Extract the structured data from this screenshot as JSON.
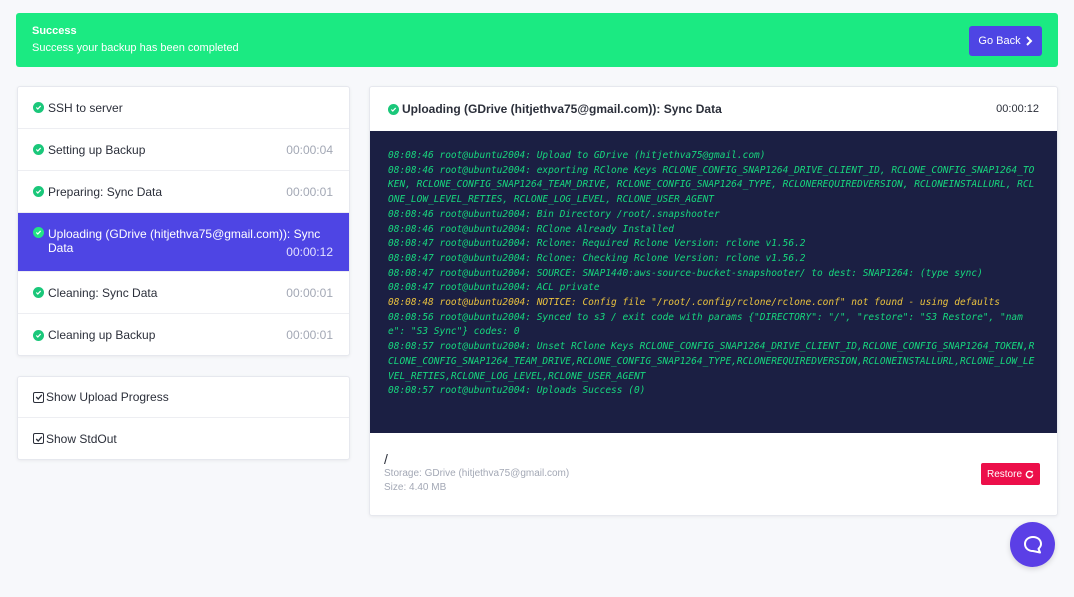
{
  "banner": {
    "title": "Success",
    "message": "Success your backup has been completed",
    "go_back_label": "Go Back",
    "bg_color": "#1bea82"
  },
  "steps": [
    {
      "label": "SSH to server",
      "duration": ""
    },
    {
      "label": "Setting up Backup",
      "duration": "00:00:04"
    },
    {
      "label": "Preparing: Sync Data",
      "duration": "00:00:01"
    },
    {
      "label": "Uploading (GDrive (hitjethva75@gmail.com)): Sync Data",
      "duration": "00:00:12",
      "active": true
    },
    {
      "label": "Cleaning: Sync Data",
      "duration": "00:00:01"
    },
    {
      "label": "Cleaning up Backup",
      "duration": "00:00:01"
    }
  ],
  "options": [
    {
      "label": "Show Upload Progress",
      "checked": true
    },
    {
      "label": "Show StdOut",
      "checked": true
    }
  ],
  "log": {
    "title": "Uploading (GDrive (hitjethva75@gmail.com)): Sync Data",
    "time": "00:00:12",
    "lines": [
      "08:08:46 root@ubuntu2004: Upload to GDrive (hitjethva75@gmail.com)",
      "08:08:46 root@ubuntu2004: exporting RClone Keys RCLONE_CONFIG_SNAP1264_DRIVE_CLIENT_ID, RCLONE_CONFIG_SNAP1264_TOKEN, RCLONE_CONFIG_SNAP1264_TEAM_DRIVE, RCLONE_CONFIG_SNAP1264_TYPE, RCLONEREQUIREDVERSION, RCLONEINSTALLURL, RCLONE_LOW_LEVEL_RETIES, RCLONE_LOG_LEVEL, RCLONE_USER_AGENT",
      "08:08:46 root@ubuntu2004: Bin Directory /root/.snapshooter",
      "08:08:46 root@ubuntu2004: RClone Already Installed",
      "08:08:47 root@ubuntu2004: Rclone: Required Rclone Version: rclone v1.56.2",
      "08:08:47 root@ubuntu2004: Rclone: Checking Rclone Version: rclone v1.56.2",
      "08:08:47 root@ubuntu2004: SOURCE: SNAP1440:aws-source-bucket-snapshooter/ to dest: SNAP1264: (type sync)",
      "08:08:47 root@ubuntu2004: ACL private",
      "08:08:48 root@ubuntu2004: NOTICE: Config file \"/root/.config/rclone/rclone.conf\" not found - using defaults",
      "08:08:56 root@ubuntu2004: Synced to s3 / exit code with params {\"DIRECTORY\": \"/\", \"restore\": \"S3 Restore\", \"name\": \"S3 Sync\"} codes: 0",
      "08:08:57 root@ubuntu2004: Unset RClone Keys RCLONE_CONFIG_SNAP1264_DRIVE_CLIENT_ID,RCLONE_CONFIG_SNAP1264_TOKEN,RCLONE_CONFIG_SNAP1264_TEAM_DRIVE,RCLONE_CONFIG_SNAP1264_TYPE,RCLONEREQUIREDVERSION,RCLONEINSTALLURL,RCLONE_LOW_LEVEL_RETIES,RCLONE_LOG_LEVEL,RCLONE_USER_AGENT",
      "08:08:57 root@ubuntu2004: Uploads Success (0)"
    ],
    "warn_line_index": 8
  },
  "result": {
    "path": "/",
    "storage": "Storage: GDrive (hitjethva75@gmail.com)",
    "size": "Size: 4.40 MB",
    "restore_label": "Restore"
  },
  "colors": {
    "accent": "#4e45e4",
    "success": "#1ac77a",
    "terminal_bg": "#1b1f43",
    "terminal_text": "#17d67e",
    "warn": "#e9c23f",
    "danger": "#ec0f4a"
  },
  "icons": {
    "go_back": "chevron-right-icon",
    "step_status": "check-circle-icon",
    "restore": "refresh-icon",
    "chat": "chat-bubble-icon"
  }
}
